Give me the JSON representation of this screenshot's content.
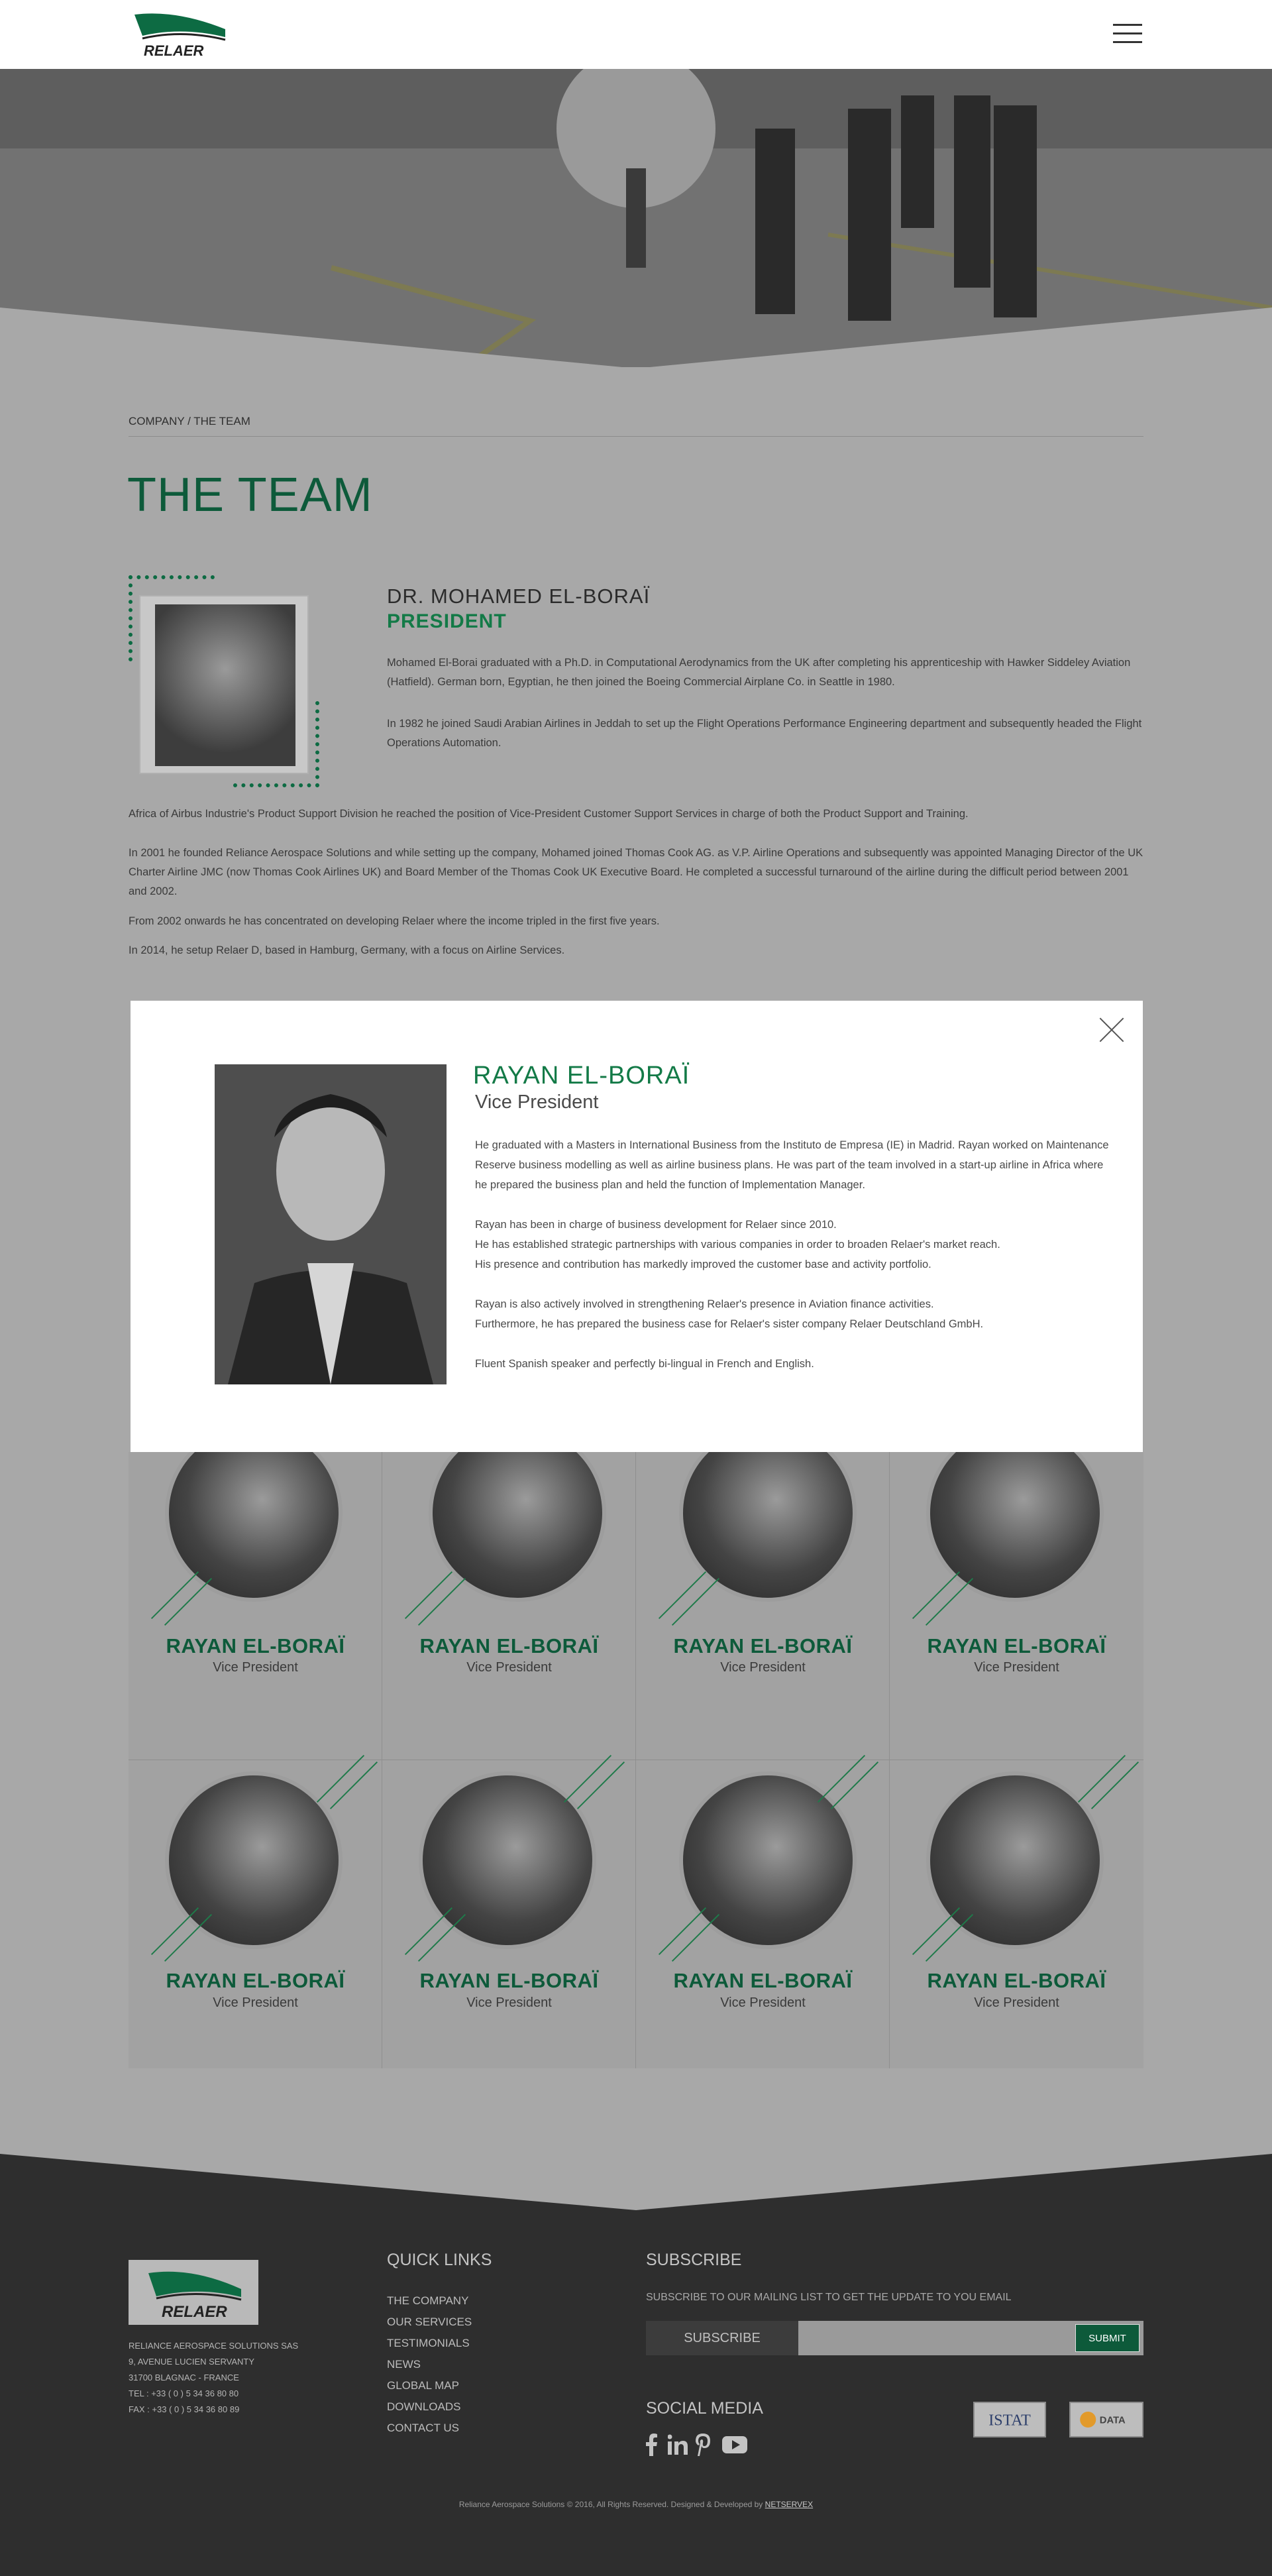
{
  "header": {
    "logo_text": "RELAER"
  },
  "breadcrumb": "COMPANY / THE TEAM",
  "page_title": "THE TEAM",
  "president": {
    "name": "DR. MOHAMED EL-BORAÏ",
    "role": "PRESIDENT",
    "paragraphs": [
      "Mohamed El-Borai graduated with a Ph.D. in Computational Aerodynamics from the UK after completing his apprenticeship with Hawker Siddeley Aviation (Hatfield). German born, Egyptian, he then joined the Boeing Commercial Airplane Co. in Seattle in 1980.",
      "In 1982 he joined Saudi Arabian Airlines in Jeddah to set up the Flight Operations Performance Engineering department and subsequently headed the Flight Operations Automation.",
      "Africa of Airbus Industrie's Product Support Division he reached the position of Vice-President Customer Support Services in charge of both the Product Support and Training.",
      "In 2001 he founded Reliance Aerospace Solutions and while setting up the company, Mohamed joined Thomas Cook AG. as V.P. Airline Operations and subsequently was appointed Managing Director of the UK Charter Airline JMC (now Thomas Cook Airlines UK) and Board Member of the Thomas Cook UK Executive Board. He completed a successful turnaround of the airline during the difficult period between 2001 and 2002.",
      "From 2002 onwards he has concentrated on developing Relaer where the income tripled in the first five years.",
      "In 2014, he setup Relaer D, based in Hamburg, Germany, with a focus on Airline Services."
    ]
  },
  "modal": {
    "name": "RAYAN EL-BORAÏ",
    "role": "Vice President",
    "paragraphs": [
      "He graduated with a Masters in International Business from the Instituto de Empresa (IE) in Madrid.  Rayan worked on Maintenance Reserve business modelling as well as airline business plans. He was part of the team involved in a start-up airline in Africa where he prepared the business plan and held the function of Implementation Manager.",
      "Rayan has been in charge of business development for Relaer since 2010.",
      "He has established strategic partnerships with various companies in order to broaden Relaer's market reach.",
      "His presence and contribution has markedly improved the customer base and activity portfolio.",
      "Rayan is also actively involved in strengthening Relaer's presence in Aviation finance activities.",
      "Furthermore, he has prepared the business case for Relaer's sister company Relaer Deutschland GmbH.",
      "Fluent Spanish speaker and perfectly bi-lingual in French and English."
    ]
  },
  "team": [
    {
      "name": "RAYAN EL-BORAÏ",
      "role": "Vice President"
    },
    {
      "name": "RAYAN EL-BORAÏ",
      "role": "Vice President"
    },
    {
      "name": "RAYAN EL-BORAÏ",
      "role": "Vice President"
    },
    {
      "name": "RAYAN EL-BORAÏ",
      "role": "Vice President"
    },
    {
      "name": "RAYAN EL-BORAÏ",
      "role": "Vice President"
    },
    {
      "name": "RAYAN EL-BORAÏ",
      "role": "Vice President"
    },
    {
      "name": "RAYAN EL-BORAÏ",
      "role": "Vice President"
    },
    {
      "name": "RAYAN EL-BORAÏ",
      "role": "Vice President"
    }
  ],
  "footer": {
    "logo_text": "RELAER",
    "address": [
      "RELIANCE AEROSPACE SOLUTIONS SAS",
      "9, AVENUE LUCIEN SERVANTY",
      "31700 BLAGNAC - FRANCE",
      "TEL : +33 ( 0 ) 5 34 36 80 80",
      "FAX : +33 ( 0 ) 5 34 36 80 89"
    ],
    "quick_links_title": "QUICK LINKS",
    "quick_links": [
      "THE COMPANY",
      "OUR SERVICES",
      "TESTIMONIALS",
      "NEWS",
      "GLOBAL MAP",
      "DOWNLOADS",
      "CONTACT US"
    ],
    "subscribe_title": "SUBSCRIBE",
    "subscribe_text": "SUBSCRIBE TO OUR MAILING LIST TO GET THE UPDATE TO YOU EMAIL",
    "subscribe_label": "SUBSCRIBE",
    "subscribe_button": "SUBMIT",
    "social_title": "SOCIAL MEDIA",
    "partner_1": "ISTAT",
    "partner_2": "DATA",
    "copyright": "Reliance Aerospace Solutions © 2016, All Rights Reserved. Designed & Developed by",
    "developer": "NETSERVEX"
  },
  "colors": {
    "brand_green": "#0d5a3a",
    "accent_green": "#137a47",
    "overlay_gray": "#a8a8a8",
    "footer_bg": "#2e2e2e"
  },
  "icons": [
    "menu-icon",
    "close-icon",
    "facebook-icon",
    "linkedin-icon",
    "pinterest-icon",
    "youtube-icon"
  ]
}
